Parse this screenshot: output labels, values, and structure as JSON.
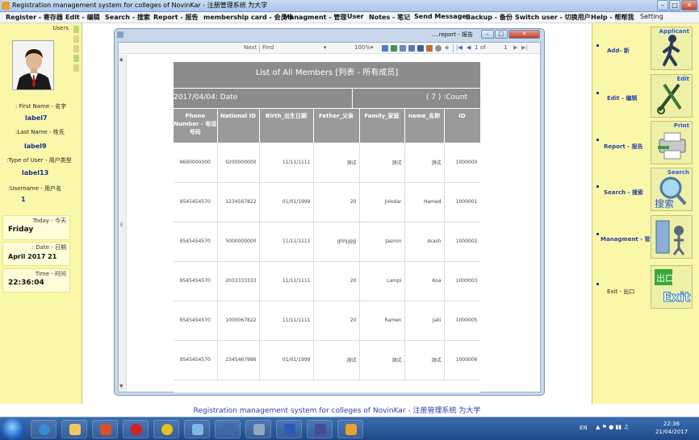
{
  "window": {
    "title": "Registration management system for colleges of NovinKar - 注册管理系统 为大学"
  },
  "menu": [
    {
      "label": "Register - 寄存器"
    },
    {
      "label": "Edit - 编辑"
    },
    {
      "label": "Search - 搜索"
    },
    {
      "label": "Report - 报告"
    },
    {
      "label": "membership card - 会员卡"
    },
    {
      "label": "Managment - 管理"
    },
    {
      "label": "User"
    },
    {
      "label": "Notes - 笔记"
    },
    {
      "label": "Send Message"
    },
    {
      "label": "Backup - 备份"
    },
    {
      "label": "Switch user - 切换用户"
    },
    {
      "label": "Help - 帮帮我"
    },
    {
      "label": "Setting"
    }
  ],
  "left_panel": {
    "users_label": "Users",
    "first_name_label": ": First Name - 名字",
    "first_name_value": "label7",
    "last_name_label": ":Last Name - 姓氏",
    "last_name_value": "label9",
    "type_label": ":Type of User - 用户类型",
    "type_value": "label13",
    "username_label": ":Username - 用户名",
    "username_value": "1",
    "today_label": "Today - 今天",
    "today_value": "Friday",
    "date_label": ": Date - 日期",
    "date_value": "April 2017 21",
    "time_label": "Time - 时间",
    "time_value": "22:36:04"
  },
  "report_window": {
    "title": "....report - 报告",
    "toolbar": {
      "next": "Next",
      "find": "Find",
      "zoom": "100%",
      "page": "1",
      "of": "of",
      "total": "1"
    }
  },
  "report": {
    "title": "List of All Members [列表 - 所有成员]",
    "date_label": "2017/04/04: Date",
    "count_label": "( 7 ) :Count",
    "columns": [
      "Phone Number - 电话号码",
      "National ID",
      "Birth_出生日期",
      "Father_父亲",
      "Family_家庭",
      "name_名称",
      "ID"
    ],
    "rows": [
      [
        "9690000000",
        "0200000000",
        "11/11/1111",
        "测试",
        "测试",
        "测试",
        "1000000"
      ],
      [
        "9545454570",
        "1234567822",
        "01/01/1999",
        "20",
        "Jolodar",
        "Hamed",
        "1000001"
      ],
      [
        "9545454570",
        "5000000000",
        "11/11/1111",
        "ghhjgjgj",
        "Jasmin",
        "Arash",
        "1000002"
      ],
      [
        "9545454570",
        "2033333333",
        "11/11/1111",
        "20",
        "Lampi",
        "Koa",
        "1000003"
      ],
      [
        "9545454570",
        "1000067822",
        "11/11/1111",
        "20",
        "Ramen",
        "Jaki",
        "1000005"
      ],
      [
        "9545454570",
        "2345467986",
        "01/01/1999",
        "测试",
        "测试",
        "测试",
        "1000006"
      ]
    ]
  },
  "right_panel": [
    {
      "label": "Add- 新",
      "tile": "Applicant",
      "icon": "applicant-icon"
    },
    {
      "label": "Edit - 编辑",
      "tile": "Edit",
      "icon": "edit-tools-icon"
    },
    {
      "label": "Report - 报告",
      "tile": "Print",
      "icon": "printer-icon"
    },
    {
      "label": "Search - 搜索",
      "tile": "Search",
      "icon": "search-magnifier-icon"
    },
    {
      "label": "Managment - 管理",
      "tile": "",
      "icon": "management-icon"
    },
    {
      "label": "Exit - 出口",
      "tile": "",
      "icon": "exit-icon"
    }
  ],
  "status_line": "Registration management system for colleges of NovinKar - 注册管理系统 为大学",
  "taskbar": {
    "lang": "EN",
    "time": "22:36",
    "date": "21/04/2017"
  }
}
